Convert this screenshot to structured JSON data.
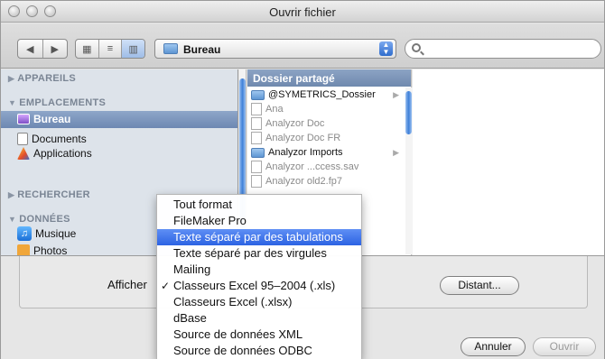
{
  "window": {
    "title": "Ouvrir fichier"
  },
  "toolbar": {
    "back_glyph": "◀",
    "forward_glyph": "▶",
    "view_icon_glyph": "▦",
    "view_list_glyph": "≡",
    "view_column_glyph": "▥",
    "path_label": "Bureau",
    "search_value": "",
    "search_placeholder": ""
  },
  "sidebar": {
    "sections": [
      {
        "label": "APPAREILS"
      },
      {
        "label": "EMPLACEMENTS"
      },
      {
        "label": "RECHERCHER"
      },
      {
        "label": "DONNÉES"
      }
    ],
    "items": {
      "bureau": "Bureau",
      "documents": "Documents",
      "applications": "Applications",
      "musique": "Musique",
      "photos": "Photos"
    }
  },
  "browser": {
    "column_header": "Dossier partagé",
    "files": [
      {
        "name": "@SYMETRICS_Dossier",
        "kind": "folder",
        "dim": false
      },
      {
        "name": "Ana",
        "kind": "file",
        "dim": true
      },
      {
        "name": "Analyzor Doc",
        "kind": "file",
        "dim": true
      },
      {
        "name": "Analyzor Doc FR",
        "kind": "file",
        "dim": true
      },
      {
        "name": "Analyzor Imports",
        "kind": "folder",
        "dim": false
      },
      {
        "name": "Analyzor ...ccess.sav",
        "kind": "file",
        "dim": true
      },
      {
        "name": "Analyzor old2.fp7",
        "kind": "file",
        "dim": true
      }
    ]
  },
  "bottom": {
    "afficher_label": "Afficher",
    "distant_label": "Distant...",
    "cancel_label": "Annuler",
    "open_label": "Ouvrir"
  },
  "menu": {
    "items": [
      "Tout format",
      "FileMaker Pro",
      "Texte séparé par des tabulations",
      "Texte séparé par des virgules",
      "Mailing",
      "Classeurs Excel 95–2004 (.xls)",
      "Classeurs Excel (.xlsx)",
      "dBase",
      "Source de données XML",
      "Source de données ODBC"
    ],
    "highlighted_index": 2,
    "checked_index": 5,
    "check_glyph": "✓"
  }
}
